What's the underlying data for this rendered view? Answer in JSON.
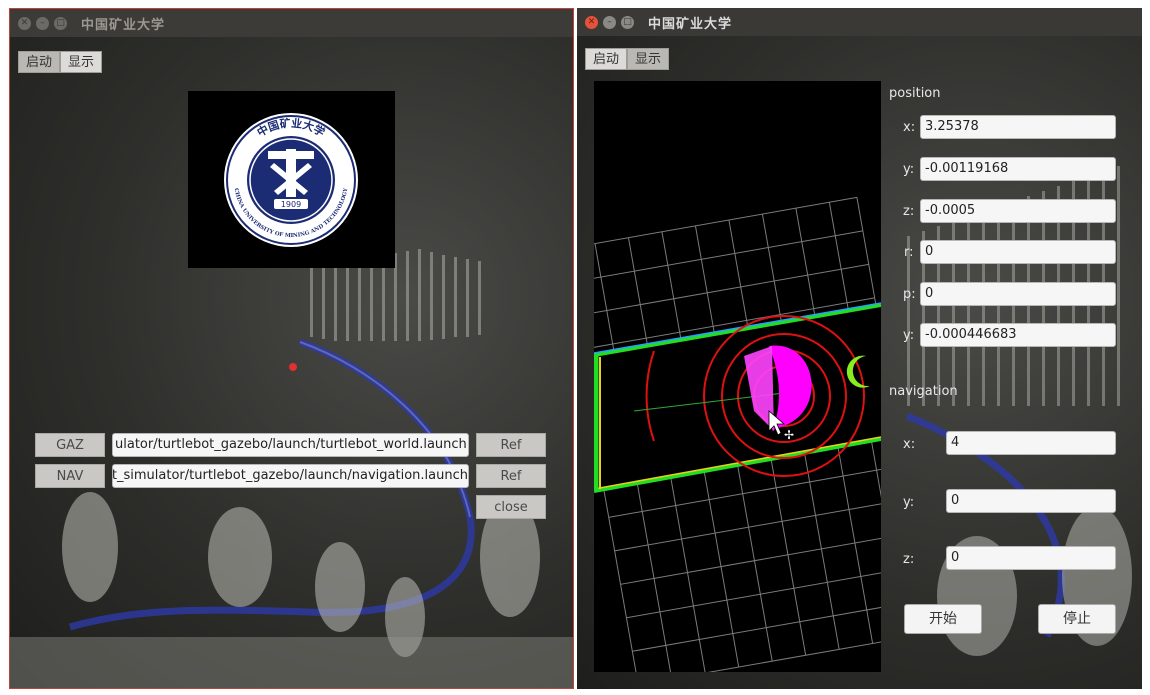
{
  "left_window": {
    "title": "中国矿业大学",
    "tabs": [
      "启动",
      "显示"
    ],
    "selected_tab": 0,
    "logo": {
      "top_text": "中国矿业大学",
      "bottom_text": "CHINA UNIVERSITY OF MINING AND TECHNOLOGY",
      "year": "1909"
    },
    "rows": [
      {
        "name": "GAZ",
        "path": "ulator/turtlebot_gazebo/launch/turtlebot_world.launch",
        "ref": "Ref"
      },
      {
        "name": "NAV",
        "path": "t_simulator/turtlebot_gazebo/launch/navigation.launch",
        "ref": "Ref"
      }
    ],
    "close_label": "close"
  },
  "right_window": {
    "title": "中国矿业大学",
    "tabs": [
      "启动",
      "显示"
    ],
    "selected_tab": 1,
    "position": {
      "heading": "position",
      "fields": [
        {
          "label": "x:",
          "value": "3.25378"
        },
        {
          "label": "y:",
          "value": "-0.00119168"
        },
        {
          "label": "z:",
          "value": "-0.0005"
        },
        {
          "label": "r:",
          "value": "0"
        },
        {
          "label": "p:",
          "value": "0"
        },
        {
          "label": "y:",
          "value": "-0.000446683"
        }
      ]
    },
    "navigation": {
      "heading": "navigation",
      "fields": [
        {
          "label": "x:",
          "value": "4"
        },
        {
          "label": "y:",
          "value": "0"
        },
        {
          "label": "z:",
          "value": "0"
        }
      ]
    },
    "start_label": "开始",
    "stop_label": "停止"
  },
  "colors": {
    "close_red": "#e2533a",
    "laser_magenta": "#ff00ff",
    "ring_red": "#dd1111",
    "map_green": "#22dd22"
  }
}
